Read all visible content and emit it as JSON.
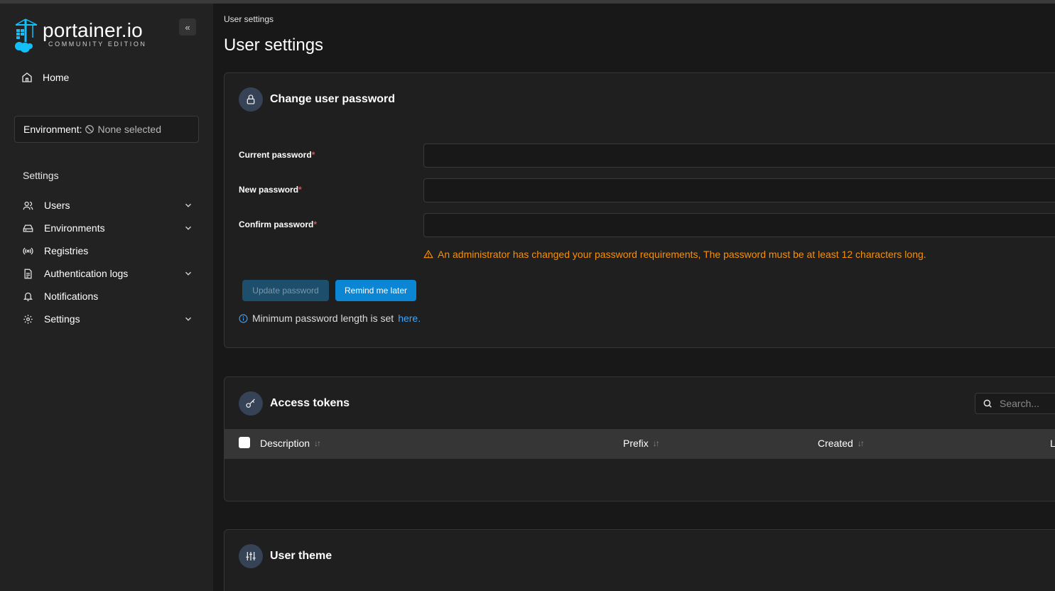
{
  "app": {
    "brand": "portainer.io",
    "edition": "COMMUNITY EDITION",
    "collapse_icon": "chevrons-left-icon"
  },
  "sidebar": {
    "home_label": "Home",
    "environment_label": "Environment:",
    "environment_value": "None selected",
    "settings_heading": "Settings",
    "items": [
      {
        "label": "Users",
        "icon": "users-icon",
        "expandable": true
      },
      {
        "label": "Environments",
        "icon": "hard-drive-icon",
        "expandable": true
      },
      {
        "label": "Registries",
        "icon": "radio-icon",
        "expandable": false
      },
      {
        "label": "Authentication logs",
        "icon": "file-text-icon",
        "expandable": true
      },
      {
        "label": "Notifications",
        "icon": "bell-icon",
        "expandable": false
      },
      {
        "label": "Settings",
        "icon": "gear-icon",
        "expandable": true
      }
    ]
  },
  "header": {
    "breadcrumb": "User settings",
    "title": "User settings"
  },
  "password_card": {
    "title": "Change user password",
    "current_label": "Current password",
    "new_label": "New password",
    "confirm_label": "Confirm password",
    "required_mark": "*",
    "current_value": "",
    "new_value": "",
    "confirm_value": "",
    "warning": "An administrator has changed your password requirements, The password must be at least 12 characters long.",
    "update_button": "Update password",
    "remind_button": "Remind me later",
    "info_text": "Minimum password length is set",
    "info_link": "here."
  },
  "tokens_card": {
    "title": "Access tokens",
    "search_placeholder": "Search...",
    "columns": [
      "Description",
      "Prefix",
      "Created",
      "L"
    ],
    "rows": []
  },
  "theme_card": {
    "title": "User theme"
  },
  "colors": {
    "accent": "#0b86d4",
    "warning": "#f79009",
    "link": "#3ba7ff",
    "sidebar_bg": "#222222",
    "page_bg": "#181818"
  }
}
